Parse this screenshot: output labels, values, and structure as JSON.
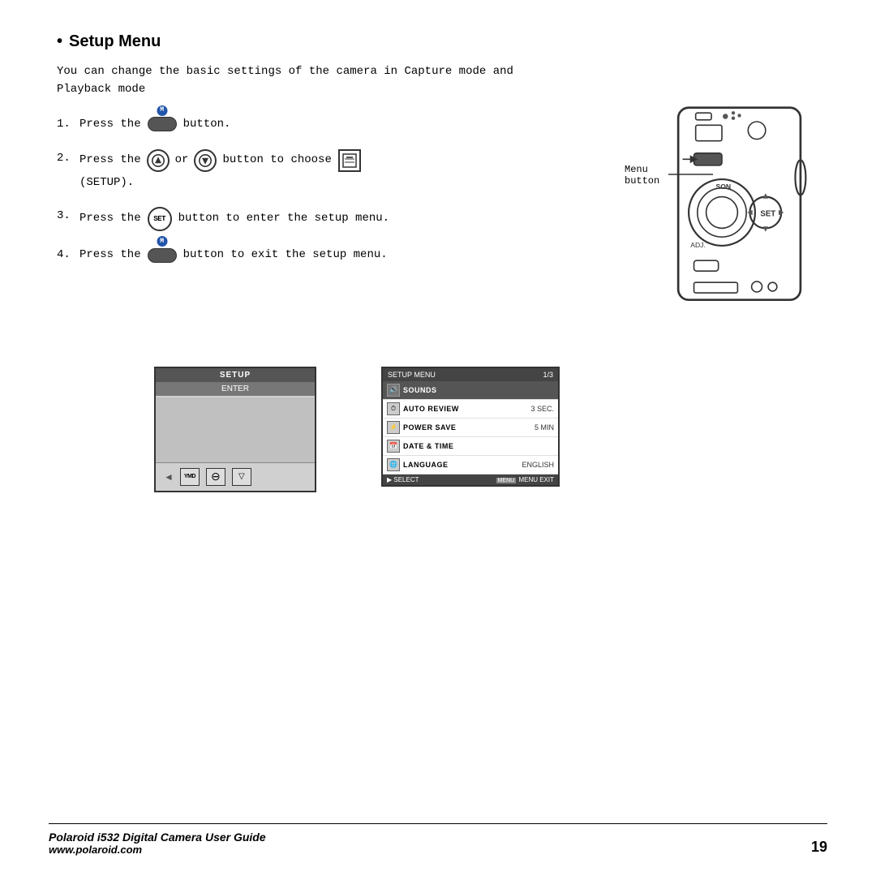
{
  "page": {
    "title": "Setup Menu",
    "intro": "You can change the basic settings of the camera in Capture mode and Playback mode",
    "steps": [
      {
        "number": "1.",
        "text_before": "Press the",
        "button": "M-pill",
        "text_after": "button."
      },
      {
        "number": "2.",
        "text_before": "Press the",
        "button": "nav-up-down",
        "text_middle": "or",
        "text_after": "button to choose",
        "icon": "SETUP",
        "extra": "(SETUP)."
      },
      {
        "number": "3.",
        "text_before": "Press the",
        "button": "SET",
        "text_after": "button to enter the setup menu."
      },
      {
        "number": "4.",
        "text_before": "Press the",
        "button": "M-pill",
        "text_after": "button to exit the setup menu."
      }
    ],
    "diagram_label": "Menu button",
    "left_screen": {
      "header": "SETUP",
      "enter": "ENTER",
      "footer_icons": [
        "YMD",
        "⊖",
        "▽"
      ]
    },
    "right_screen": {
      "header_left": "SETUP MENU",
      "header_right": "1/3",
      "items": [
        {
          "icon": "🔊",
          "label": "SOUNDS",
          "value": "",
          "highlighted": true
        },
        {
          "icon": "⏱",
          "label": "AUTO REVIEW",
          "value": "3 SEC."
        },
        {
          "icon": "⚡",
          "label": "POWER SAVE",
          "value": "5 MIN"
        },
        {
          "icon": "📅",
          "label": "DATE & TIME",
          "value": ""
        },
        {
          "icon": "🌐",
          "label": "LANGUAGE",
          "value": "ENGLISH"
        }
      ],
      "footer_left": "▶ SELECT",
      "footer_right": "MENU EXIT"
    },
    "footer": {
      "left_line1": "Polaroid i532 Digital Camera User Guide",
      "left_line2": "www.polaroid.com",
      "page_number": "19"
    }
  }
}
